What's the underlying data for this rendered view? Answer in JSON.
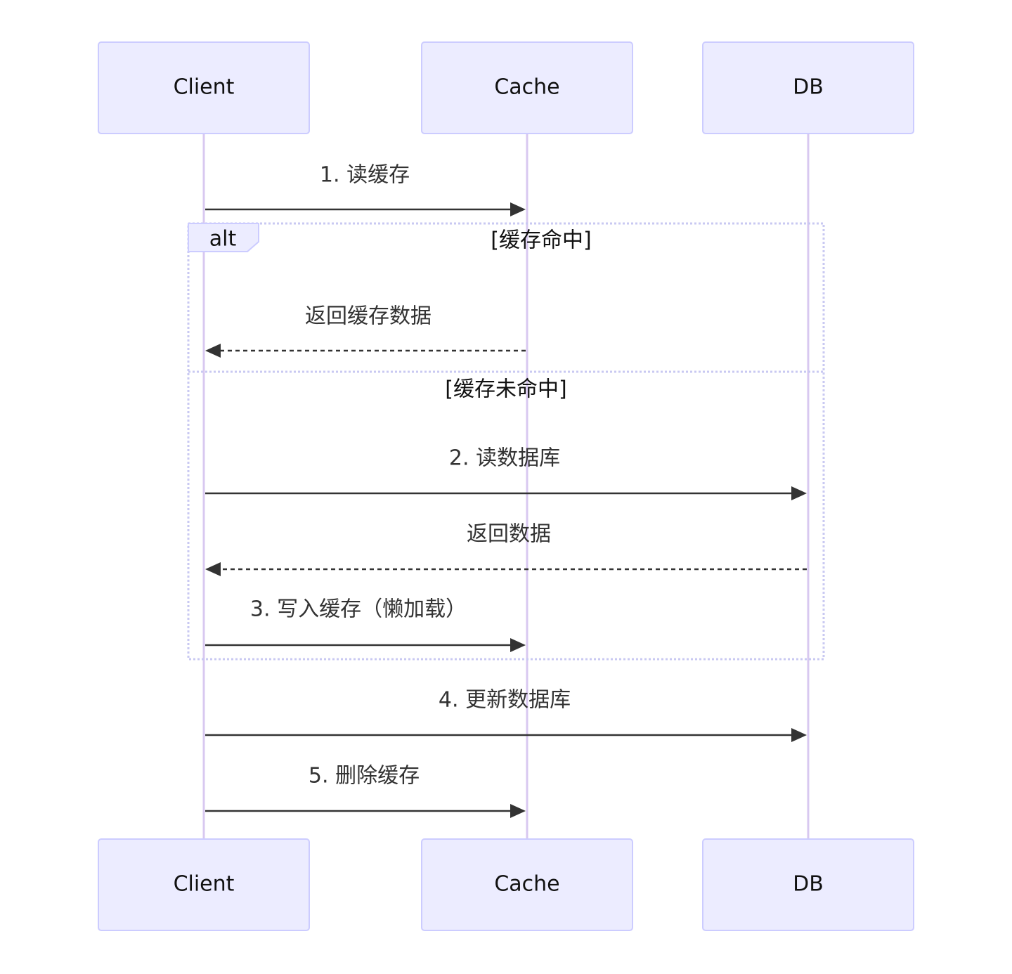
{
  "participants": [
    {
      "id": "client",
      "label": "Client"
    },
    {
      "id": "cache",
      "label": "Cache"
    },
    {
      "id": "db",
      "label": "DB"
    }
  ],
  "messages": [
    {
      "id": "m1",
      "label": "1. 读缓存",
      "from": "Client",
      "to": "Cache",
      "style": "solid"
    },
    {
      "id": "m2",
      "label": "返回缓存数据",
      "from": "Cache",
      "to": "Client",
      "style": "dashed"
    },
    {
      "id": "m3",
      "label": "2. 读数据库",
      "from": "Client",
      "to": "DB",
      "style": "solid"
    },
    {
      "id": "m4",
      "label": "返回数据",
      "from": "DB",
      "to": "Client",
      "style": "dashed"
    },
    {
      "id": "m5",
      "label": "3. 写入缓存（懒加载）",
      "from": "Client",
      "to": "Cache",
      "style": "solid"
    },
    {
      "id": "m6",
      "label": "4. 更新数据库",
      "from": "Client",
      "to": "DB",
      "style": "solid"
    },
    {
      "id": "m7",
      "label": "5. 删除缓存",
      "from": "Client",
      "to": "Cache",
      "style": "solid"
    }
  ],
  "alt_frame": {
    "label": "alt",
    "conditions": [
      "[缓存命中]",
      "[缓存未命中]"
    ]
  },
  "colors": {
    "actor_fill": "#ECECFF",
    "actor_border": "#CCCCFF",
    "lifeline": "#D8C8F0",
    "message": "#333333",
    "frame_border": "#C9C9F2"
  }
}
